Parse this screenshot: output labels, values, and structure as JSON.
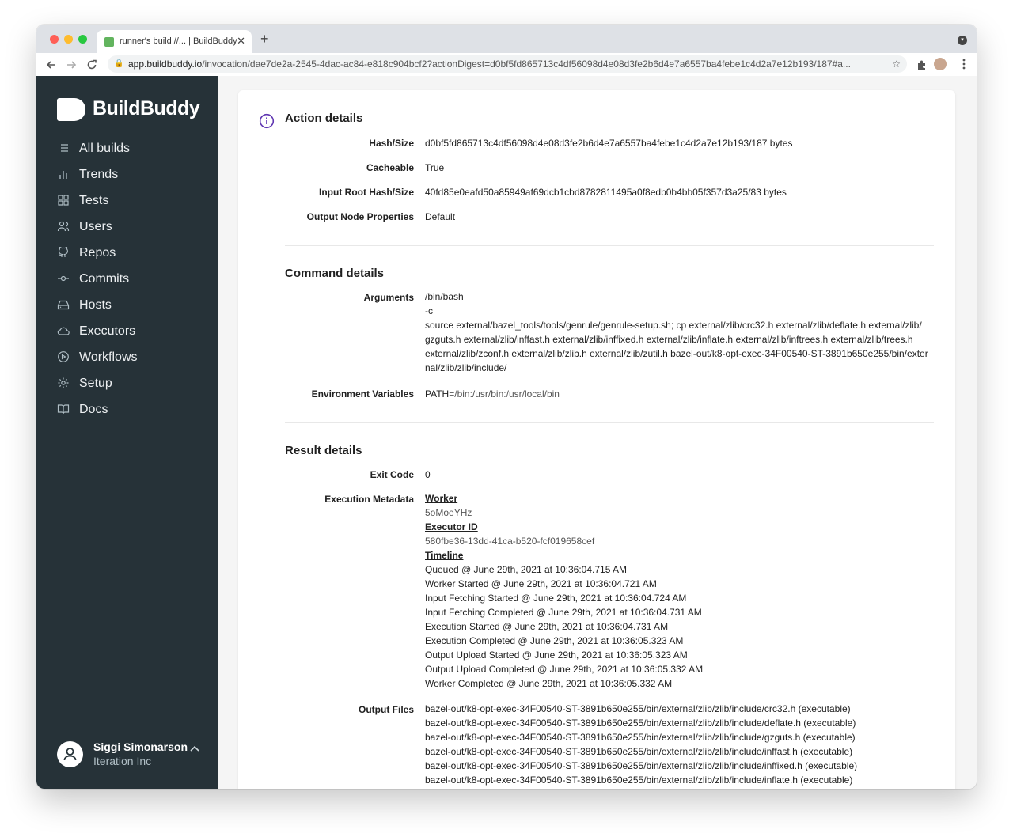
{
  "browser": {
    "tab_title": "runner's build //... | BuildBuddy",
    "tab_close": "✕",
    "new_tab": "+",
    "url_host": "app.buildbuddy.io",
    "url_path": "/invocation/dae7de2a-2545-4dac-ac84-e818c904bcf2?actionDigest=d0bf5fd865713c4df56098d4e08d3fe2b6d4e7a6557ba4febe1c4d2a7e12b193/187#a...",
    "icons": [
      "back-icon",
      "forward-icon",
      "reload-icon",
      "lock-icon",
      "star-icon",
      "extensions-icon",
      "menu-icon"
    ]
  },
  "sidebar": {
    "logo_text": "BuildBuddy",
    "items": [
      {
        "label": "All builds",
        "icon": "list-icon"
      },
      {
        "label": "Trends",
        "icon": "bar-chart-icon"
      },
      {
        "label": "Tests",
        "icon": "grid-icon"
      },
      {
        "label": "Users",
        "icon": "users-icon"
      },
      {
        "label": "Repos",
        "icon": "github-icon"
      },
      {
        "label": "Commits",
        "icon": "commit-icon"
      },
      {
        "label": "Hosts",
        "icon": "hard-drive-icon"
      },
      {
        "label": "Executors",
        "icon": "cloud-icon"
      },
      {
        "label": "Workflows",
        "icon": "play-circle-icon"
      },
      {
        "label": "Setup",
        "icon": "settings-icon"
      },
      {
        "label": "Docs",
        "icon": "book-icon"
      }
    ],
    "user": {
      "name": "Siggi Simonarson",
      "org": "Iteration Inc"
    }
  },
  "action": {
    "title": "Action details",
    "hash_label": "Hash/Size",
    "hash_value": "d0bf5fd865713c4df56098d4e08d3fe2b6d4e7a6557ba4febe1c4d2a7e12b193/187 bytes",
    "cacheable_label": "Cacheable",
    "cacheable_value": "True",
    "input_root_label": "Input Root Hash/Size",
    "input_root_value": "40fd85e0eafd50a85949af69dcb1cbd8782811495a0f8edb0b4bb05f357d3a25/83 bytes",
    "output_node_label": "Output Node Properties",
    "output_node_value": "Default"
  },
  "command": {
    "title": "Command details",
    "arguments_label": "Arguments",
    "arguments": [
      "/bin/bash",
      "-c",
      "source external/bazel_tools/tools/genrule/genrule-setup.sh; cp external/zlib/crc32.h external/zlib/deflate.h external/zlib/",
      "gzguts.h external/zlib/inffast.h external/zlib/inffixed.h external/zlib/inflate.h external/zlib/inftrees.h external/zlib/trees.h",
      "external/zlib/zconf.h external/zlib/zlib.h external/zlib/zutil.h bazel-out/k8-opt-exec-34F00540-ST-3891b650e255/bin/exter",
      "nal/zlib/zlib/include/"
    ],
    "env_label": "Environment Variables",
    "env_name": "PATH",
    "env_value": "=/bin:/usr/bin:/usr/local/bin"
  },
  "result": {
    "title": "Result details",
    "exit_code_label": "Exit Code",
    "exit_code_value": "0",
    "metadata_label": "Execution Metadata",
    "worker_heading": "Worker",
    "worker_value": "5oMoeYHz",
    "executor_heading": "Executor ID",
    "executor_value": "580fbe36-13dd-41ca-b520-fcf019658cef",
    "timeline_heading": "Timeline",
    "timeline": [
      "Queued @ June 29th, 2021 at 10:36:04.715 AM",
      "Worker Started @ June 29th, 2021 at 10:36:04.721 AM",
      "Input Fetching Started @ June 29th, 2021 at 10:36:04.724 AM",
      "Input Fetching Completed @ June 29th, 2021 at 10:36:04.731 AM",
      "Execution Started @ June 29th, 2021 at 10:36:04.731 AM",
      "Execution Completed @ June 29th, 2021 at 10:36:05.323 AM",
      "Output Upload Started @ June 29th, 2021 at 10:36:05.323 AM",
      "Output Upload Completed @ June 29th, 2021 at 10:36:05.332 AM",
      "Worker Completed @ June 29th, 2021 at 10:36:05.332 AM"
    ],
    "output_files_label": "Output Files",
    "output_files": [
      "bazel-out/k8-opt-exec-34F00540-ST-3891b650e255/bin/external/zlib/zlib/include/crc32.h (executable)",
      "bazel-out/k8-opt-exec-34F00540-ST-3891b650e255/bin/external/zlib/zlib/include/deflate.h (executable)",
      "bazel-out/k8-opt-exec-34F00540-ST-3891b650e255/bin/external/zlib/zlib/include/gzguts.h (executable)",
      "bazel-out/k8-opt-exec-34F00540-ST-3891b650e255/bin/external/zlib/zlib/include/inffast.h (executable)",
      "bazel-out/k8-opt-exec-34F00540-ST-3891b650e255/bin/external/zlib/zlib/include/inffixed.h (executable)",
      "bazel-out/k8-opt-exec-34F00540-ST-3891b650e255/bin/external/zlib/zlib/include/inflate.h (executable)"
    ]
  },
  "colors": {
    "sidebar_bg": "#263238",
    "accent": "#5e35b1"
  }
}
